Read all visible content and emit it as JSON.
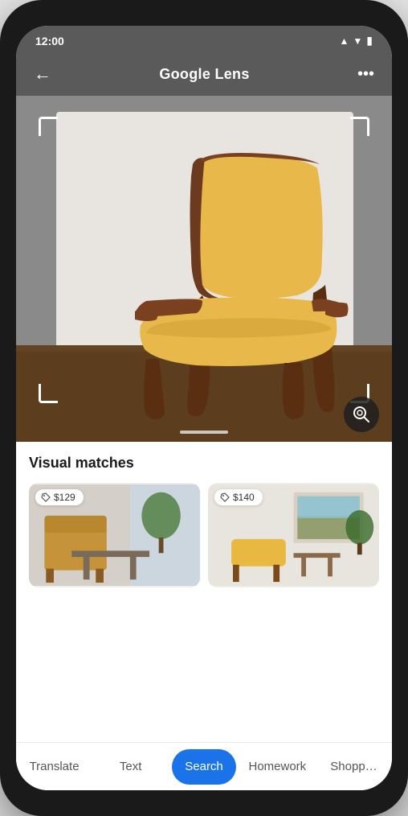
{
  "phone": {
    "status_time": "12:00",
    "signal_icon": "▲",
    "wifi_icon": "▼",
    "battery_icon": "▮"
  },
  "header": {
    "back_label": "←",
    "title_regular": "Google ",
    "title_bold": "Lens",
    "more_label": "•••"
  },
  "results": {
    "section_title": "Visual matches",
    "matches": [
      {
        "price": "$129"
      },
      {
        "price": "$140"
      }
    ]
  },
  "tabs": [
    {
      "id": "translate",
      "label": "Translate",
      "active": false
    },
    {
      "id": "text",
      "label": "Text",
      "active": false
    },
    {
      "id": "search",
      "label": "Search",
      "active": true
    },
    {
      "id": "homework",
      "label": "Homework",
      "active": false
    },
    {
      "id": "shopping",
      "label": "Shopp…",
      "active": false
    }
  ]
}
